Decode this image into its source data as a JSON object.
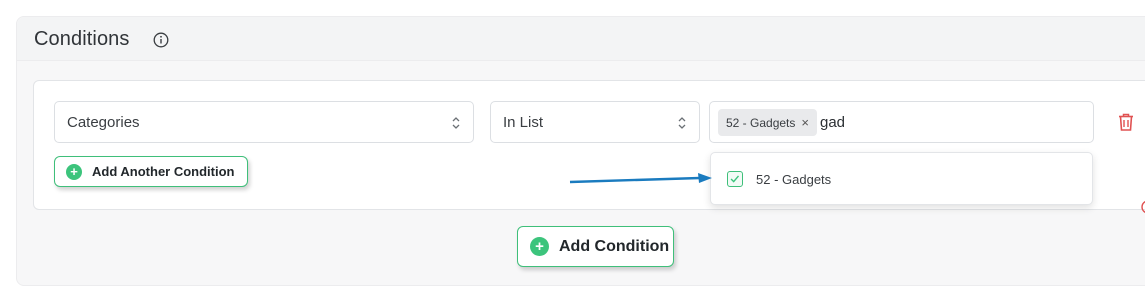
{
  "section": {
    "title": "Conditions",
    "info_icon": "info-circle-icon"
  },
  "condition_row": {
    "field_select": {
      "value": "Categories"
    },
    "operator_select": {
      "value": "In List"
    },
    "value_input": {
      "tags": [
        {
          "label": "52 - Gadgets",
          "remove_symbol": "×"
        }
      ],
      "typed_text": "gad"
    },
    "delete_icon": "trash-icon"
  },
  "dropdown": {
    "options": [
      {
        "label": "52 - Gadgets",
        "checked": true
      }
    ]
  },
  "buttons": {
    "add_another": "Add Another Condition",
    "add_condition": "Add Condition",
    "plus_symbol": "+"
  },
  "colors": {
    "accent_green": "#3cc47c",
    "delete_red": "#e05252",
    "annotation_arrow": "#1a7bbf"
  }
}
